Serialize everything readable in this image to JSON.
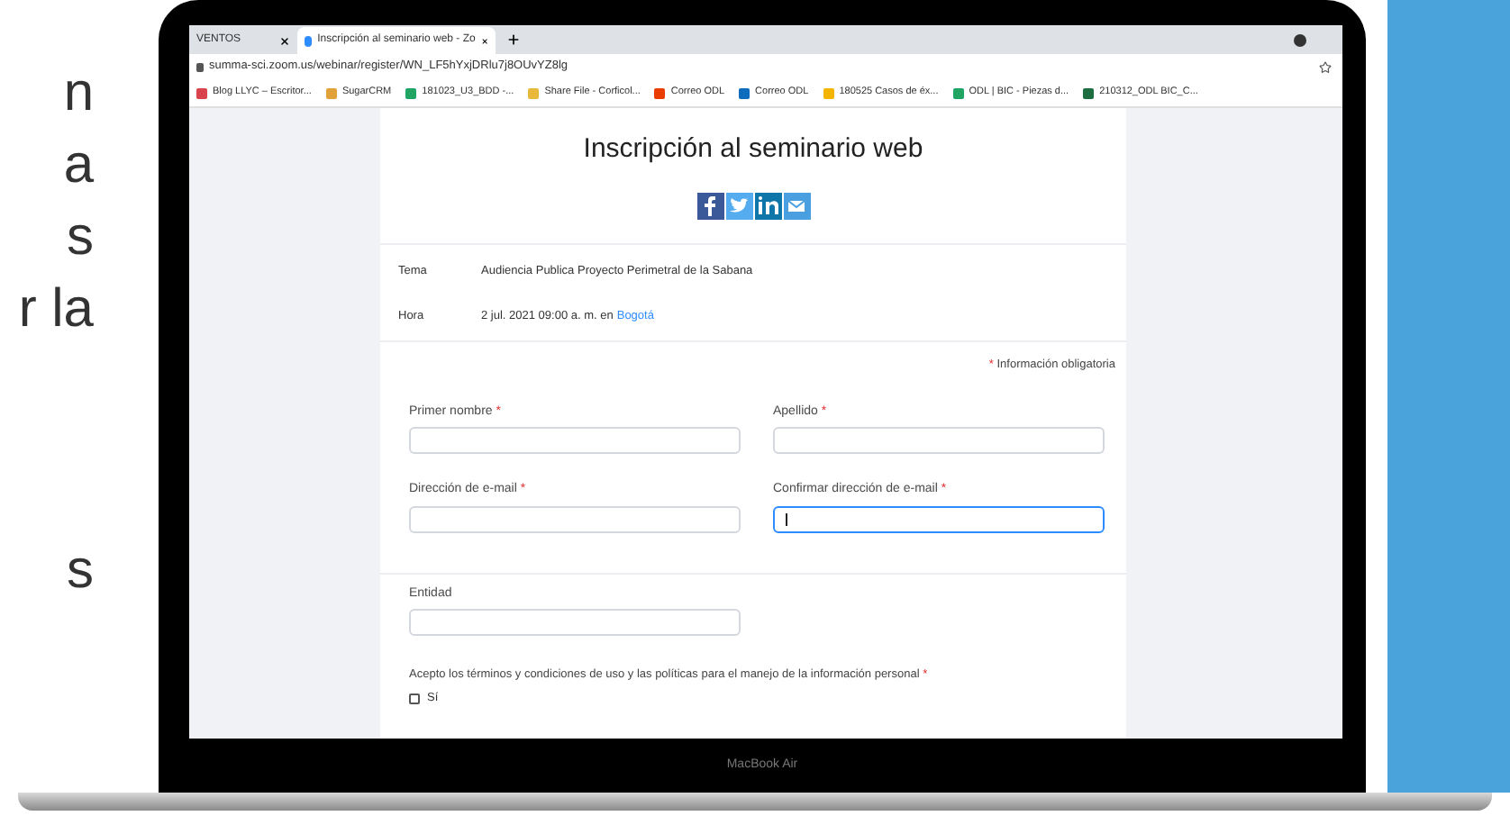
{
  "side_text": [
    "n",
    "a",
    "s",
    "r la",
    "s"
  ],
  "browser": {
    "tabs": [
      {
        "title": "VENTOS",
        "selected": false
      },
      {
        "title": "Inscripción al seminario web - Zo",
        "selected": true
      }
    ],
    "url": "summa-sci.zoom.us/webinar/register/WN_LF5hYxjDRlu7j8OUvYZ8lg",
    "bookmarks": [
      {
        "label": "Blog LLYC – Escritor...",
        "color": "#d9434b"
      },
      {
        "label": "SugarCRM",
        "color": "#e2a13a"
      },
      {
        "label": "181023_U3_BDD -...",
        "color": "#1fa463"
      },
      {
        "label": "Share File - Corficol...",
        "color": "#e8b83b"
      },
      {
        "label": "Correo ODL",
        "color": "#eb3c00"
      },
      {
        "label": "Correo ODL",
        "color": "#0f6cbd"
      },
      {
        "label": "180525 Casos de éx...",
        "color": "#f4b400"
      },
      {
        "label": "ODL | BIC - Piezas d...",
        "color": "#1fa463"
      },
      {
        "label": "210312_ODL BIC_C...",
        "color": "#1d6f42"
      }
    ]
  },
  "page": {
    "title": "Inscripción al seminario web",
    "details": [
      {
        "label": "Tema",
        "value": "Audiencia Publica Proyecto Perimetral de la Sabana"
      },
      {
        "label": "Hora",
        "value": "2 jul. 2021 09:00 a. m. en",
        "link": "Bogotá"
      }
    ],
    "required_mark": "*",
    "required_note": "Información obligatoria",
    "fields": [
      {
        "label": "Primer nombre",
        "required": true,
        "focused": false
      },
      {
        "label": "Apellido",
        "required": true,
        "focused": false
      },
      {
        "label": "Dirección de e-mail",
        "required": true,
        "focused": false
      },
      {
        "label": "Confirmar dirección de e-mail",
        "required": true,
        "focused": true
      }
    ],
    "extra_fields": [
      {
        "label": "Entidad",
        "required": false,
        "focused": false
      }
    ],
    "consent": {
      "text": "Acepto los términos y condiciones de uso y las políticas para el manejo de la información personal",
      "required": true,
      "option": "Sí",
      "checked": false
    }
  },
  "laptop_label": "MacBook Air"
}
